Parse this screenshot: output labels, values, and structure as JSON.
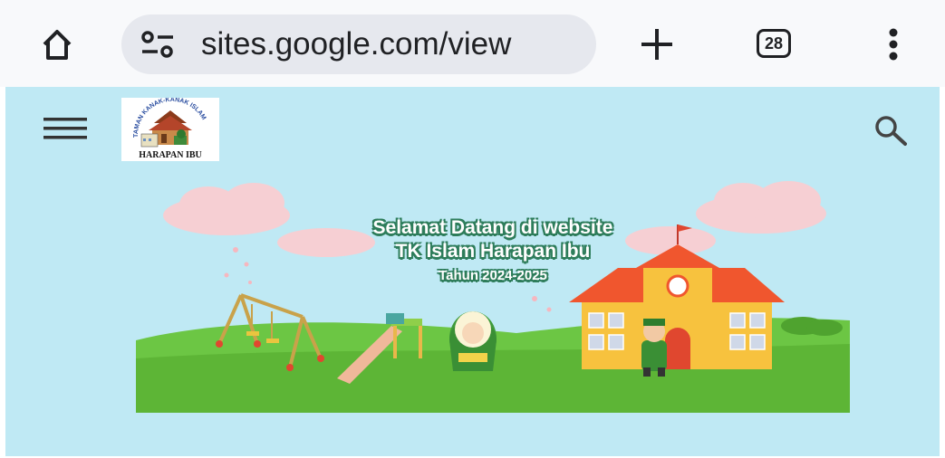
{
  "browser": {
    "url": "sites.google.com/view",
    "tab_count": "28"
  },
  "site": {
    "logo_arc_text": "TAMAN KANAK-KANAK ISLAM",
    "logo_name": "HARAPAN IBU",
    "hero": {
      "line1": "Selamat Datang di website",
      "line2": "TK Islam Harapan Ibu",
      "line3": "Tahun 2024-2025"
    }
  },
  "colors": {
    "site_background": "#bfe9f4",
    "grass": "#6cc644",
    "school_wall": "#f7c23e",
    "school_roof": "#f0562e",
    "text_outline": "#2e7d5b"
  }
}
